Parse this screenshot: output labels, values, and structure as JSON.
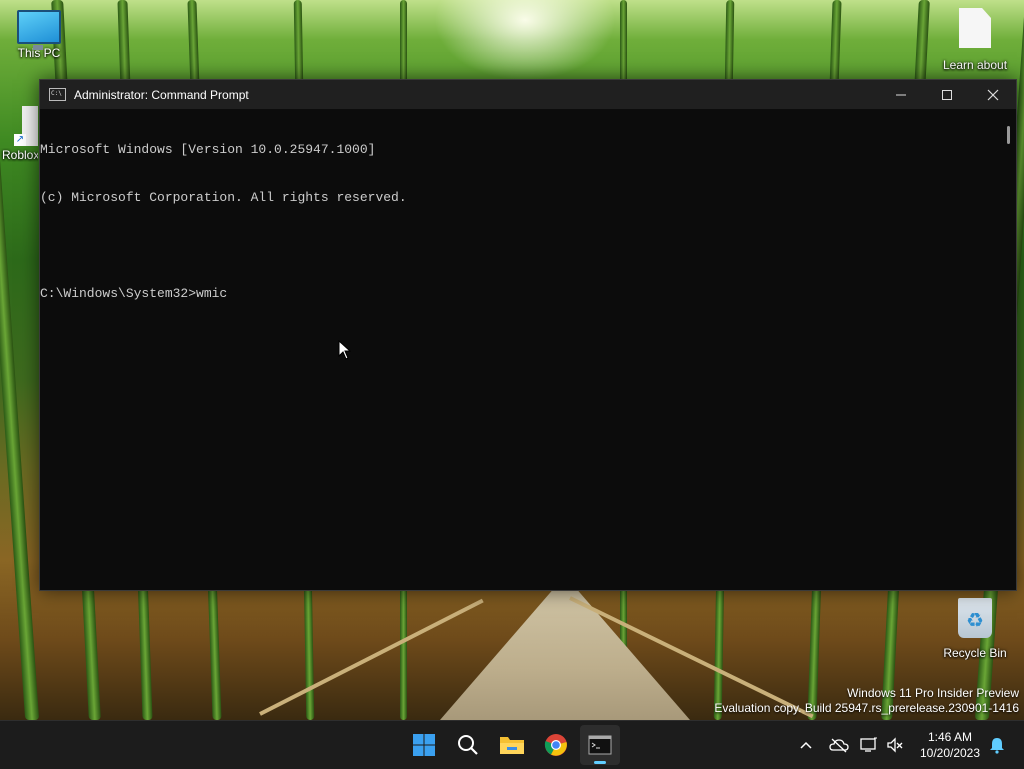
{
  "desktop": {
    "icons": [
      {
        "label": "This PC",
        "icon": "this-pc-icon"
      },
      {
        "label": "Roblox",
        "icon": "roblox-shortcut-icon"
      },
      {
        "label": "Learn about",
        "icon": "document-icon"
      },
      {
        "label": "Recycle Bin",
        "icon": "recycle-bin-icon"
      }
    ]
  },
  "window": {
    "title": "Administrator: Command Prompt",
    "icon": "cmd-icon",
    "console_lines": [
      "Microsoft Windows [Version 10.0.25947.1000]",
      "(c) Microsoft Corporation. All rights reserved.",
      "",
      "C:\\Windows\\System32>wmic"
    ]
  },
  "watermark": {
    "line1": "Windows 11 Pro Insider Preview",
    "line2": "Evaluation copy. Build 25947.rs_prerelease.230901-1416"
  },
  "taskbar": {
    "apps": [
      "start-icon",
      "search-icon",
      "file-explorer-icon",
      "chrome-icon",
      "terminal-icon"
    ],
    "tray_icons": [
      "chevron-up-icon",
      "network-off-icon",
      "display-icon",
      "volume-muted-icon"
    ],
    "time": "1:46 AM",
    "date": "10/20/2023",
    "notification_icon": "bell-icon"
  },
  "colors": {
    "console_bg": "#0c0c0c",
    "console_text": "#cccccc",
    "titlebar": "#202020",
    "taskbar": "#1c1c1c",
    "accent": "#60cdff"
  }
}
